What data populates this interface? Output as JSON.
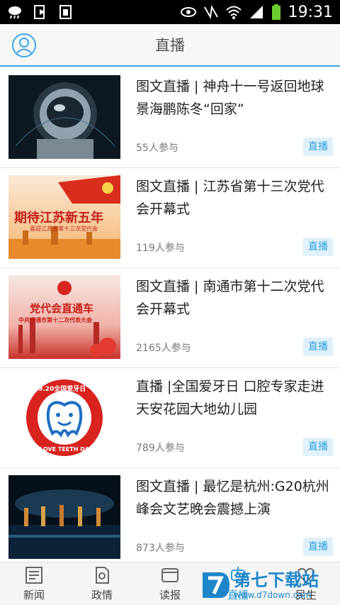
{
  "status_bar": {
    "time": "19:31"
  },
  "header": {
    "title": "直播"
  },
  "items": [
    {
      "title": "图文直播 | 神舟十一号返回地球景海鹏陈冬“回家”",
      "count": "55人参与",
      "badge": "直播"
    },
    {
      "title": "图文直播 | 江苏省第十三次党代会开幕式",
      "count": "119人参与",
      "badge": "直播",
      "thumb_text_main": "期待江苏新五年",
      "thumb_text_sub": "喜迎江苏省第十三次党代会"
    },
    {
      "title": "图文直播 | 南通市第十二次党代会开幕式",
      "count": "2165人参与",
      "badge": "直播",
      "thumb_text_main": "党代会直通车",
      "thumb_text_sub": "中共南通市第十二次代表大会"
    },
    {
      "title": "直播 |全国爱牙日 口腔专家走进天安花园大地幼儿园",
      "count": "789人参与",
      "badge": "直播",
      "thumb_text_top": "9.20全国爱牙日",
      "thumb_text_bottom": "LOVE TEETH DAY"
    },
    {
      "title": "图文直播 | 最忆是杭州:G20杭州峰会文艺晚会震撼上演",
      "count": "873人参与",
      "badge": "直播"
    }
  ],
  "tabs": [
    {
      "label": "新闻",
      "icon": "newspaper-icon"
    },
    {
      "label": "政情",
      "icon": "document-icon"
    },
    {
      "label": "读报",
      "icon": "book-icon"
    },
    {
      "label": "直播",
      "icon": "live-icon"
    },
    {
      "label": "民生",
      "icon": "heart-icon"
    }
  ],
  "watermark": {
    "cn": "第七下载站",
    "url": "www.d7down.com"
  },
  "colors": {
    "accent": "#2f9fde",
    "badge_bg": "#dff1fb",
    "header_border": "#39a6e8"
  }
}
